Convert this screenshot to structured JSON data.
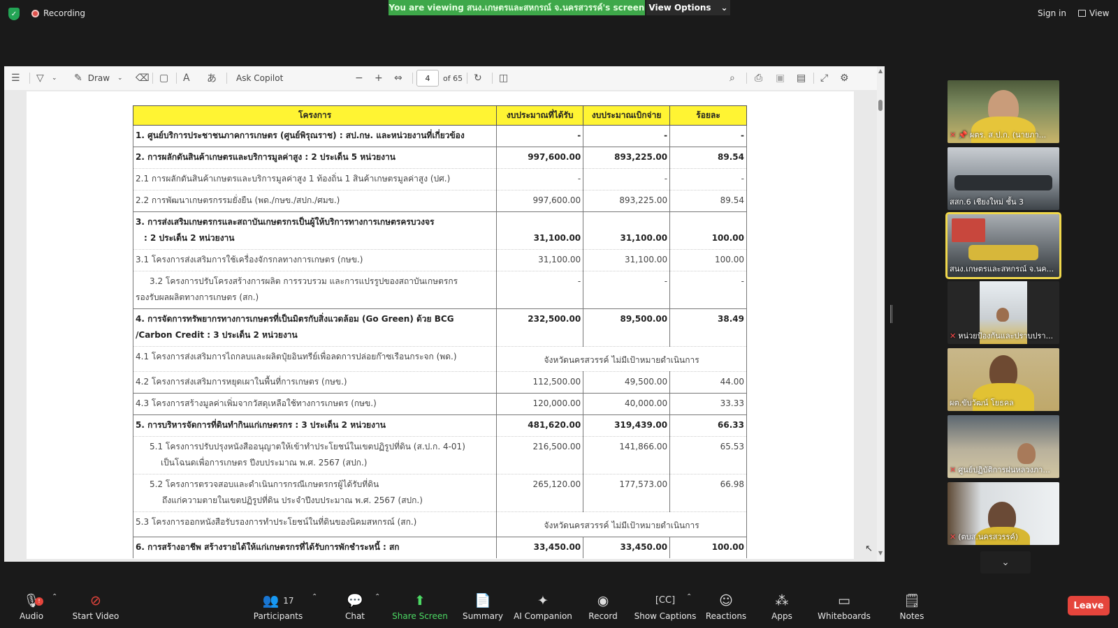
{
  "topbar": {
    "recording_label": "Recording",
    "viewing_banner": "You are viewing สนง.เกษตรและสหกรณ์ จ.นครสวรรค์'s screen",
    "view_options_label": "View Options",
    "sign_in_label": "Sign in",
    "view_label": "View"
  },
  "pdf_toolbar": {
    "draw_label": "Draw",
    "ask_copilot_label": "Ask Copilot",
    "page_current": "4",
    "page_total": "of 65"
  },
  "table": {
    "headers": [
      "โครงการ",
      "งบประมาณที่ได้รับ",
      "งบประมาณเบิกจ่าย",
      "ร้อยละ"
    ],
    "not_target_text": "จังหวัดนครสวรรค์ ไม่มีเป้าหมายดำเนินการ",
    "rows": {
      "r1": {
        "label": "1. ศูนย์บริการประชาชนภาคการเกษตร (ศูนย์พิรุณราช) : สป.กษ. และหน่วยงานที่เกี่ยวข้อง",
        "received": "-",
        "spent": "-",
        "percent": "-"
      },
      "r2": {
        "label": "2. การผลักดันสินค้าเกษตรและบริการมูลค่าสูง : 2 ประเด็น 5 หน่วยงาน",
        "received": "997,600.00",
        "spent": "893,225.00",
        "percent": "89.54"
      },
      "r2_1": {
        "label": "2.1 การผลักดันสินค้าเกษตรและบริการมูลค่าสูง 1 ท้องถิ่น 1 สินค้าเกษตรมูลค่าสูง (ปศ.)",
        "received": "-",
        "spent": "-",
        "percent": "-"
      },
      "r2_2": {
        "label": "2.2 การพัฒนาเกษตรกรรมยั่งยืน (พด./กษข./สปก./ศมข.)",
        "received": "997,600.00",
        "spent": "893,225.00",
        "percent": "89.54"
      },
      "r3": {
        "label_line1": "3. การส่งเสริมเกษตรกรและสถาบันเกษตรกรเป็นผู้ให้บริการทางการเกษตรครบวงจร",
        "label_line2": ": 2 ประเด็น 2 หน่วยงาน",
        "received": "31,100.00",
        "spent": "31,100.00",
        "percent": "100.00"
      },
      "r3_1": {
        "label": "3.1 โครงการส่งเสริมการใช้เครื่องจักรกลทางการเกษตร (กษข.)",
        "received": "31,100.00",
        "spent": "31,100.00",
        "percent": "100.00"
      },
      "r3_2": {
        "label_line1": "3.2 โครงการปรับโครงสร้างการผลิต การรวบรวม และการแปรรูปของสถาบันเกษตรกร",
        "label_line2": "รองรับผลผลิตทางการเกษตร (สก.)",
        "received": "-",
        "spent": "-",
        "percent": "-"
      },
      "r4": {
        "label_line1": "4. การจัดการทรัพยากรทางการเกษตรที่เป็นมิตรกับสิ่งแวดล้อม (Go Green) ด้วย BCG",
        "label_line2": "/Carbon Credit  : 3 ประเด็น 2 หน่วยงาน",
        "received": "232,500.00",
        "spent": "89,500.00",
        "percent": "38.49"
      },
      "r4_1": {
        "label": "4.1 โครงการส่งเสริมการไถกลบและผลิตปุ๋ยอินทรีย์เพื่อลดการปล่อยก๊าซเรือนกระจก (พด.)"
      },
      "r4_2": {
        "label": "4.2 โครงการส่งเสริมการหยุดเผาในพื้นที่การเกษตร (กษข.)",
        "received": "112,500.00",
        "spent": "49,500.00",
        "percent": "44.00"
      },
      "r4_3": {
        "label": "4.3 โครงการสร้างมูลค่าเพิ่มจากวัสดุเหลือใช้ทางการเกษตร (กษข.)",
        "received": "120,000.00",
        "spent": "40,000.00",
        "percent": "33.33"
      },
      "r5": {
        "label": "5. การบริหารจัดการที่ดินทำกินแก่เกษตรกร  : 3 ประเด็น 2 หน่วยงาน",
        "received": "481,620.00",
        "spent": "319,439.00",
        "percent": "66.33"
      },
      "r5_1": {
        "label_line1": "5.1 โครงการปรับปรุงหนังสืออนุญาตให้เข้าทำประโยชน์ในเขตปฏิรูปที่ดิน (ส.ป.ก. 4-01)",
        "label_line2": "เป็นโฉนดเพื่อการเกษตร ปีงบประมาณ พ.ศ. 2567 (สปก.)",
        "received": "216,500.00",
        "spent": "141,866.00",
        "percent": "65.53"
      },
      "r5_2": {
        "label_line1": "5.2 โครงการตรวจสอบและดำเนินการกรณีเกษตรกรผู้ได้รับที่ดิน",
        "label_line2": "ถึงแก่ความตายในเขตปฏิรูปที่ดิน ประจำปีงบประมาณ พ.ศ. 2567 (สปก.)",
        "received": "265,120.00",
        "spent": "177,573.00",
        "percent": "66.98"
      },
      "r5_3": {
        "label": "5.3 โครงการออกหนังสือรับรองการทำประโยชน์ในที่ดินของนิคมสหกรณ์ (สก.)"
      },
      "r6": {
        "label": "6. การสร้างอาชีพ สร้างรายได้ให้แก่เกษตรกรที่ได้รับการพักชำระหนี้ : สก",
        "received": "33,450.00",
        "spent": "33,450.00",
        "percent": "100.00"
      }
    }
  },
  "participants_gallery": [
    {
      "name": "ผตร. ส.ป.ก. (นายภา...",
      "muted": true,
      "pinned": true
    },
    {
      "name": "สสก.6 เชียงใหม่ ชั้น 3",
      "muted": false,
      "pinned": false
    },
    {
      "name": "สนง.เกษตรและสหกรณ์ จ.นค...",
      "muted": false,
      "pinned": false,
      "active": true
    },
    {
      "name": "หน่วยป้องกันและปราบปรา...",
      "muted": true,
      "pinned": false
    },
    {
      "name": "ผต.ขับวัฒน์ โยธคล",
      "muted": false,
      "pinned": false
    },
    {
      "name": "ศูนย์ปฏิบัติการฝนหลวงภา...",
      "muted": true,
      "pinned": false
    },
    {
      "name": "(ตบส.นครสวรรค์)",
      "muted": true,
      "pinned": false
    }
  ],
  "bottombar": {
    "audio_label": "Audio",
    "audio_badge": "!",
    "video_label": "Start Video",
    "participants_label": "Participants",
    "participants_count": "17",
    "chat_label": "Chat",
    "share_label": "Share Screen",
    "summary_label": "Summary",
    "ai_label": "AI Companion",
    "record_label": "Record",
    "captions_label": "Show Captions",
    "reactions_label": "Reactions",
    "apps_label": "Apps",
    "whiteboards_label": "Whiteboards",
    "notes_label": "Notes",
    "leave_label": "Leave"
  },
  "colors": {
    "header_yellow": "#fff433",
    "banner_green": "#3ea84a",
    "leave_red": "#e5453c",
    "active_tile": "#f0d84c"
  }
}
